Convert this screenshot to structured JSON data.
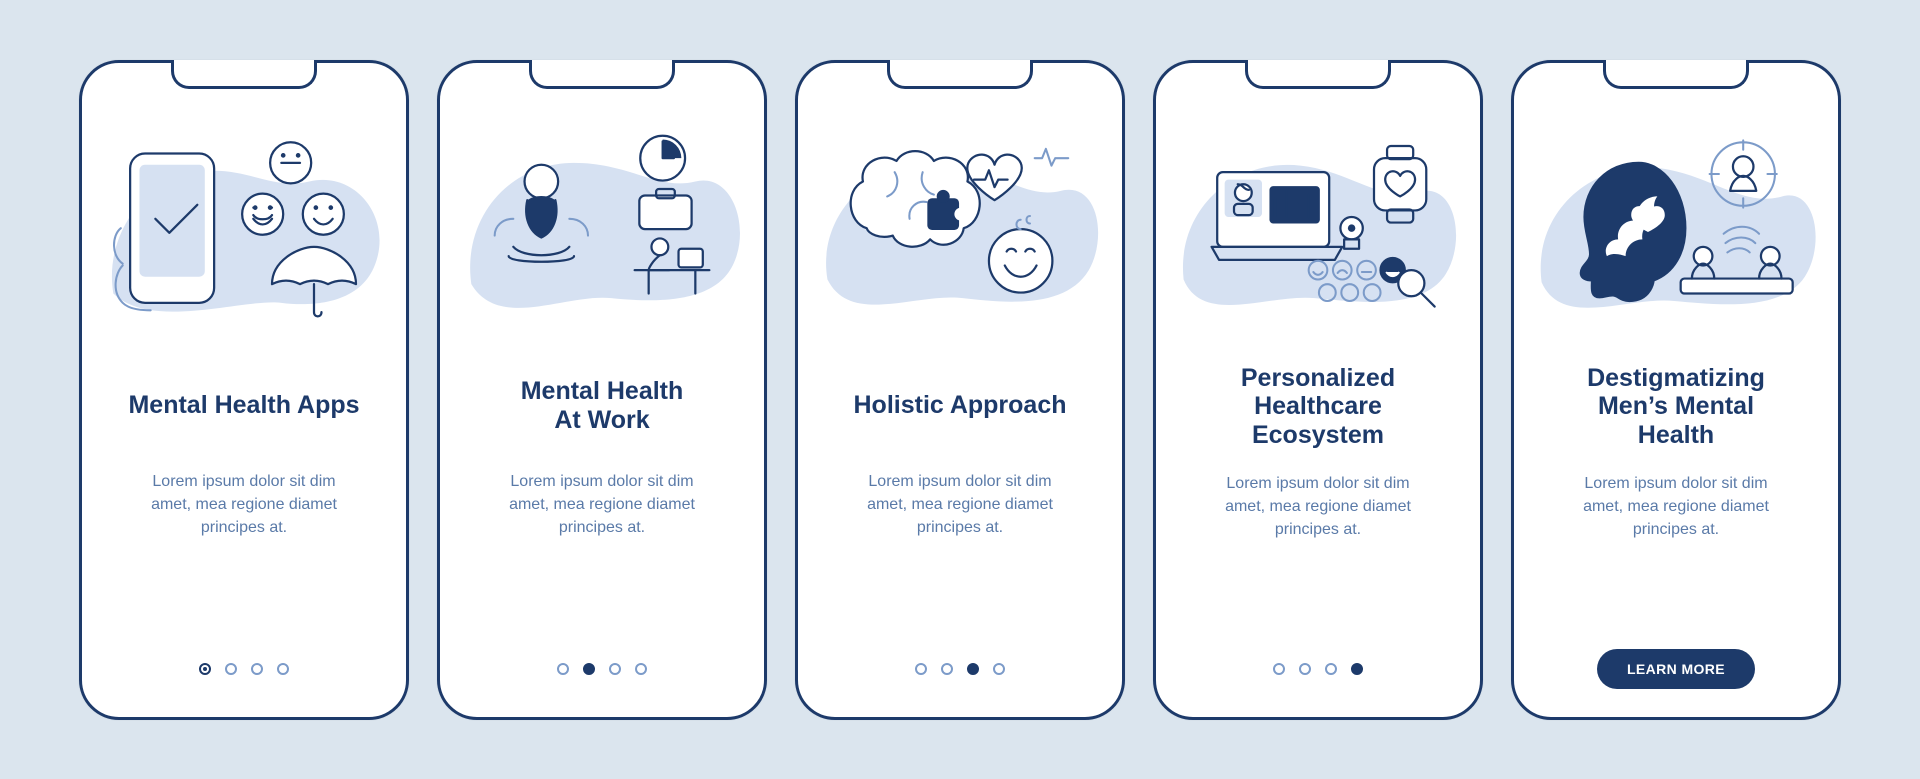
{
  "colors": {
    "bg": "#dbe5ee",
    "card": "#ffffff",
    "stroke": "#1d3a6a",
    "strokeLight": "#7c9bc9",
    "pale": "#d6e1f2",
    "title": "#1d3a6a",
    "body": "#5a7aa8",
    "accent": "#1d3a6a"
  },
  "cards": [
    {
      "icon_name": "mental-health-apps-icon",
      "title": "Mental Health Apps",
      "body": "Lorem ipsum dolor sit dim\namet, mea regione diamet\nprincipes at.",
      "footer": {
        "type": "dots",
        "active": 0,
        "filled": false
      }
    },
    {
      "icon_name": "mental-health-at-work-icon",
      "title": "Mental Health\nAt Work",
      "body": "Lorem ipsum dolor sit dim\namet, mea regione diamet\nprincipes at.",
      "footer": {
        "type": "dots",
        "active": 1,
        "filled": true
      }
    },
    {
      "icon_name": "holistic-approach-icon",
      "title": "Holistic Approach",
      "body": "Lorem ipsum dolor sit dim\namet, mea regione diamet\nprincipes at.",
      "footer": {
        "type": "dots",
        "active": 2,
        "filled": true
      }
    },
    {
      "icon_name": "personalized-healthcare-icon",
      "title": "Personalized\nHealthcare\nEcosystem",
      "body": "Lorem ipsum dolor sit dim\namet, mea regione diamet\nprincipes at.",
      "footer": {
        "type": "dots",
        "active": 3,
        "filled": true
      }
    },
    {
      "icon_name": "destigmatizing-mens-health-icon",
      "title": "Destigmatizing\nMen’s Mental\nHealth",
      "body": "Lorem ipsum dolor sit dim\namet, mea regione diamet\nprincipes at.",
      "footer": {
        "type": "cta",
        "label": "LEARN MORE"
      }
    }
  ],
  "dots_total": 4,
  "cta": {
    "label": "LEARN MORE"
  },
  "chart_data": null
}
